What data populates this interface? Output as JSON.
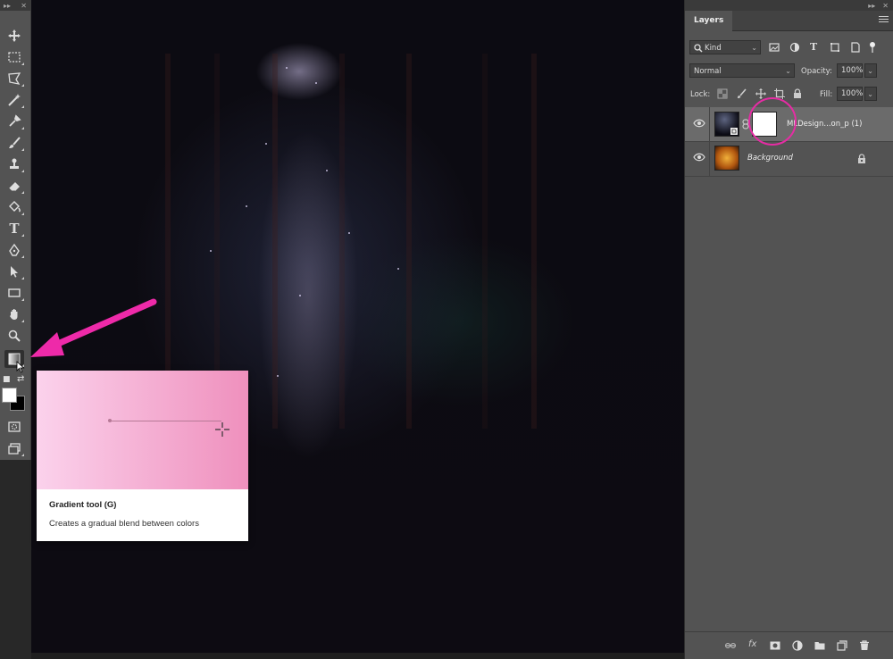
{
  "toolbar": {
    "collapse_glyph": "▸▸",
    "close_glyph": "✕",
    "tools": [
      {
        "id": "move-tool",
        "icon": "move-icon"
      },
      {
        "id": "marquee-tool",
        "icon": "rectangular-marquee-icon"
      },
      {
        "id": "lasso-tool",
        "icon": "polygonal-lasso-icon"
      },
      {
        "id": "magic-wand-tool",
        "icon": "magic-wand-icon"
      },
      {
        "id": "eyedropper-tool",
        "icon": "eyedropper-icon"
      },
      {
        "id": "brush-tool",
        "icon": "brush-icon"
      },
      {
        "id": "clone-stamp-tool",
        "icon": "clone-stamp-icon"
      },
      {
        "id": "eraser-tool",
        "icon": "eraser-icon"
      },
      {
        "id": "paint-bucket-tool",
        "icon": "paint-bucket-icon"
      },
      {
        "id": "type-tool",
        "icon": "type-icon",
        "glyph": "T"
      },
      {
        "id": "pen-tool",
        "icon": "pen-icon"
      },
      {
        "id": "path-selection-tool",
        "icon": "path-selection-icon"
      },
      {
        "id": "rectangle-tool",
        "icon": "rectangle-icon"
      },
      {
        "id": "hand-tool",
        "icon": "hand-icon"
      },
      {
        "id": "zoom-tool",
        "icon": "zoom-icon"
      },
      {
        "id": "gradient-tool",
        "icon": "gradient-icon",
        "active": true
      },
      {
        "id": "quick-mask-tool",
        "icon": "quick-mask-icon"
      },
      {
        "id": "screen-mode-tool",
        "icon": "screen-mode-icon"
      }
    ],
    "foreground_color": "#ffffff",
    "background_color": "#000000"
  },
  "tooltip": {
    "title": "Gradient tool (G)",
    "description": "Creates a gradual blend between colors",
    "preview_colors": [
      "#fbd2ec",
      "#ef90bd"
    ]
  },
  "annotation": {
    "arrow_color": "#ee2aa9",
    "circle_color": "#e62ca4"
  },
  "panel": {
    "tab_label": "Layers",
    "filter_kind": "Kind",
    "blend_mode": "Normal",
    "opacity_label": "Opacity:",
    "opacity_value": "100%",
    "lock_label": "Lock:",
    "fill_label": "Fill:",
    "fill_value": "100%",
    "layers": [
      {
        "name": "MLDesign...on_p (1)",
        "selected": true,
        "has_mask": true
      },
      {
        "name": "Background",
        "italic": true,
        "locked": true
      }
    ],
    "bottom_icons": [
      "link-icon",
      "fx-icon",
      "add-mask-icon",
      "adjustment-icon",
      "folder-icon",
      "new-layer-icon",
      "trash-icon"
    ],
    "fx_label": "fx"
  }
}
